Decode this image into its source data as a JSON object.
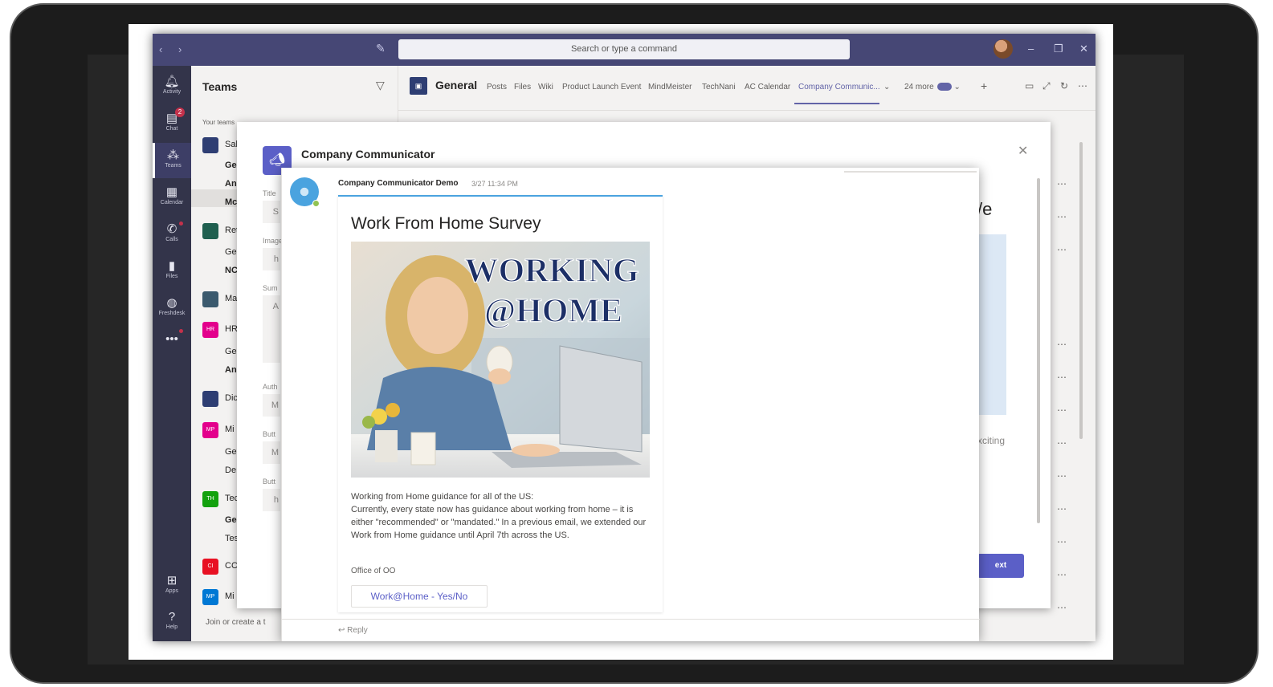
{
  "titlebar": {
    "search_placeholder": "Search or type a command",
    "back_icon": "chevron-left-icon",
    "forward_icon": "chevron-right-icon",
    "compose_icon": "compose-icon"
  },
  "rail": {
    "items": [
      {
        "label": "Activity",
        "icon": "bell-icon"
      },
      {
        "label": "Chat",
        "icon": "chat-icon",
        "badge": "2"
      },
      {
        "label": "Teams",
        "icon": "teams-icon"
      },
      {
        "label": "Calendar",
        "icon": "calendar-icon"
      },
      {
        "label": "Calls",
        "icon": "phone-icon"
      },
      {
        "label": "Files",
        "icon": "file-icon"
      },
      {
        "label": "Freshdesk",
        "icon": "freshdesk-icon"
      },
      {
        "label": "Apps",
        "icon": "apps-icon"
      },
      {
        "label": "Help",
        "icon": "help-icon"
      }
    ],
    "more": "•••"
  },
  "teams_list": {
    "title": "Teams",
    "your_teams": "Your teams",
    "join_create": "Join or create a t",
    "entries": [
      {
        "type": "team",
        "text": "Sal",
        "tile_color": "#2e3e73",
        "tile": "",
        "y": 0
      },
      {
        "type": "chan",
        "text": "Ge",
        "bold": true
      },
      {
        "type": "chan",
        "text": "An",
        "bold": true
      },
      {
        "type": "chan",
        "text": "Mc",
        "bold": true
      },
      {
        "type": "team",
        "text": "Ret",
        "tile_color": "#1f5f4f",
        "tile": ""
      },
      {
        "type": "chan",
        "text": "Ge",
        "bold": false
      },
      {
        "type": "chan",
        "text": "NC",
        "bold": true
      },
      {
        "type": "team",
        "text": "Ma",
        "tile_color": "#3b5a6e",
        "tile": ""
      },
      {
        "type": "team",
        "text": "HR",
        "tile_color": "#e3008c",
        "tile": "HR"
      },
      {
        "type": "chan",
        "text": "Ge",
        "bold": false
      },
      {
        "type": "chan",
        "text": "An",
        "bold": true
      },
      {
        "type": "team",
        "text": "Dic",
        "tile_color": "#2e3e73",
        "tile": ""
      },
      {
        "type": "team",
        "text": "Mi",
        "tile_color": "#e3008c",
        "tile": "MP"
      },
      {
        "type": "chan",
        "text": "Ge",
        "bold": false
      },
      {
        "type": "chan",
        "text": "De",
        "bold": false
      },
      {
        "type": "team",
        "text": "Tec",
        "tile_color": "#13a10e",
        "tile": "TH"
      },
      {
        "type": "chan",
        "text": "Ge",
        "bold": true
      },
      {
        "type": "chan",
        "text": "Tes",
        "bold": false
      },
      {
        "type": "team",
        "text": "CC",
        "tile_color": "#e81123",
        "tile": "CI"
      },
      {
        "type": "team",
        "text": "Mi",
        "tile_color": "#0078d4",
        "tile": "MP"
      }
    ]
  },
  "channel": {
    "name": "General",
    "tabs": [
      "Posts",
      "Files",
      "Wiki",
      "Product Launch Event",
      "MindMeister",
      "TechNani",
      "AC Calendar",
      "Company Communic...",
      "24 more"
    ],
    "active_tab": "Company Communic..."
  },
  "back_modal": {
    "title": "Company Communicator",
    "fields": [
      "Title",
      "Image",
      "Sum",
      "Auth",
      "Butt",
      "Butt"
    ],
    "field_values": [
      "S",
      "h",
      "A",
      "M",
      "M",
      "h"
    ],
    "right_text": "/e",
    "exciting_text": "xciting",
    "next_label": "ext"
  },
  "message": {
    "sender": "Company Communicator Demo",
    "time": "3/27 11:34 PM",
    "reply": "Reply",
    "card": {
      "title": "Work From Home Survey",
      "image_text_line1": "WORKING",
      "image_text_line2": "@HOME",
      "body_lines": [
        "Working from Home guidance for all of the US:",
        "Currently, every state now has guidance about working from home – it is either \"recommended\" or \"mandated.\" In a previous email, we extended our Work from Home guidance until April 7th across the US."
      ],
      "signature": "Office of OO",
      "button_label": "Work@Home - Yes/No"
    }
  },
  "colors": {
    "titlebar": "#464775",
    "rail": "#33344a",
    "accent": "#6264a7",
    "card_accent": "#4aa3df"
  }
}
